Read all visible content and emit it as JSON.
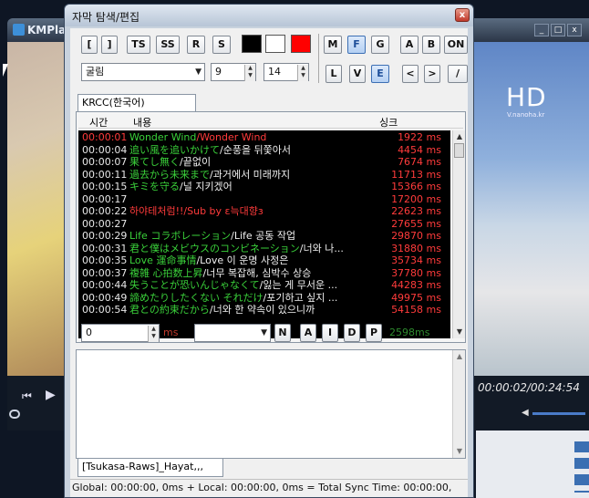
{
  "background_app": {
    "title": "KMPlayer",
    "video_logo": "HD",
    "video_logo_sub": "V.nanoha.kr",
    "time_readout": "00:00:02/00:24:54",
    "window_buttons": [
      "_",
      "□",
      "x"
    ]
  },
  "dialog": {
    "title": "자막 탐색/편집",
    "close": "x",
    "toolbar_row1": [
      "[",
      "]",
      "TS",
      "SS",
      "R",
      "S"
    ],
    "toolbar_row1_right": [
      "M",
      "F",
      "G",
      "A",
      "B",
      "ON"
    ],
    "toolbar_row2_right": [
      "L",
      "V",
      "E",
      "<",
      ">",
      "/"
    ],
    "swatch_colors": [
      "#000000",
      "#ffffff",
      "#ff0000"
    ],
    "font_name": "굴림",
    "font_size": "9",
    "line_height": "14",
    "tab_label": "KRCC(한국어)",
    "columns": {
      "time": "시간",
      "content": "내용",
      "sync": "싱크"
    },
    "rows": [
      {
        "time": "00:00:01",
        "text_a": "Wonder Wind",
        "text_b": "/Wonder Wind",
        "ms": "1922 ms",
        "style": "first"
      },
      {
        "time": "00:00:04",
        "text_a": "追い風を追いかけて",
        "text_b": "/순풍을 뒤쫓아서",
        "ms": "4454 ms"
      },
      {
        "time": "00:00:07",
        "text_a": "果てし無く",
        "text_b": "/끝없이",
        "ms": "7674 ms"
      },
      {
        "time": "00:00:11",
        "text_a": "過去から未来まで",
        "text_b": "/과거에서 미래까지",
        "ms": "11713 ms"
      },
      {
        "time": "00:00:15",
        "text_a": "キミを守る",
        "text_b": "/널 지키겠어",
        "ms": "15366 ms"
      },
      {
        "time": "00:00:17",
        "text_a": "",
        "text_b": "",
        "ms": "17200 ms"
      },
      {
        "time": "00:00:22",
        "text_a": "",
        "text_b": "하야테처럼!!/Sub by ε늑대향з",
        "ms": "22623 ms",
        "style": "red"
      },
      {
        "time": "00:00:27",
        "text_a": "",
        "text_b": "",
        "ms": "27655 ms"
      },
      {
        "time": "00:00:29",
        "text_a": "Life コラボレーション",
        "text_b": "/Life 공동 작업",
        "ms": "29870 ms"
      },
      {
        "time": "00:00:31",
        "text_a": "君と僕はメビウスのコンビネーション",
        "text_b": "/너와 나...",
        "ms": "31880 ms"
      },
      {
        "time": "00:00:35",
        "text_a": "Love 運命事情",
        "text_b": "/Love 이 운명 사정은",
        "ms": "35734 ms"
      },
      {
        "time": "00:00:37",
        "text_a": "複雑 心拍数上昇",
        "text_b": "/너무 복잡해, 심박수 상승",
        "ms": "37780 ms"
      },
      {
        "time": "00:00:44",
        "text_a": "失うことが恐いんじゃなくて",
        "text_b": "/잃는 게 무서운 ...",
        "ms": "44283 ms"
      },
      {
        "time": "00:00:49",
        "text_a": "諦めたりしたくない それだけ",
        "text_b": "/포기하고 싶지 ...",
        "ms": "49975 ms"
      },
      {
        "time": "00:00:54",
        "text_a": "君との約束だから",
        "text_b": "/너와 한 약속이 있으니까",
        "ms": "54158 ms"
      }
    ],
    "sync_value": "0",
    "sync_unit": "ms",
    "edit_buttons": [
      "N",
      "A",
      "I",
      "D",
      "P"
    ],
    "current_ms": "2598ms",
    "file_tab": "[Tsukasa-Raws]_Hayat,,,",
    "status": "Global: 00:00:00, 0ms  +  Local: 00:00:00, 0ms = Total Sync Time: 00:00:00,",
    "accent": "#3c6fb4"
  }
}
